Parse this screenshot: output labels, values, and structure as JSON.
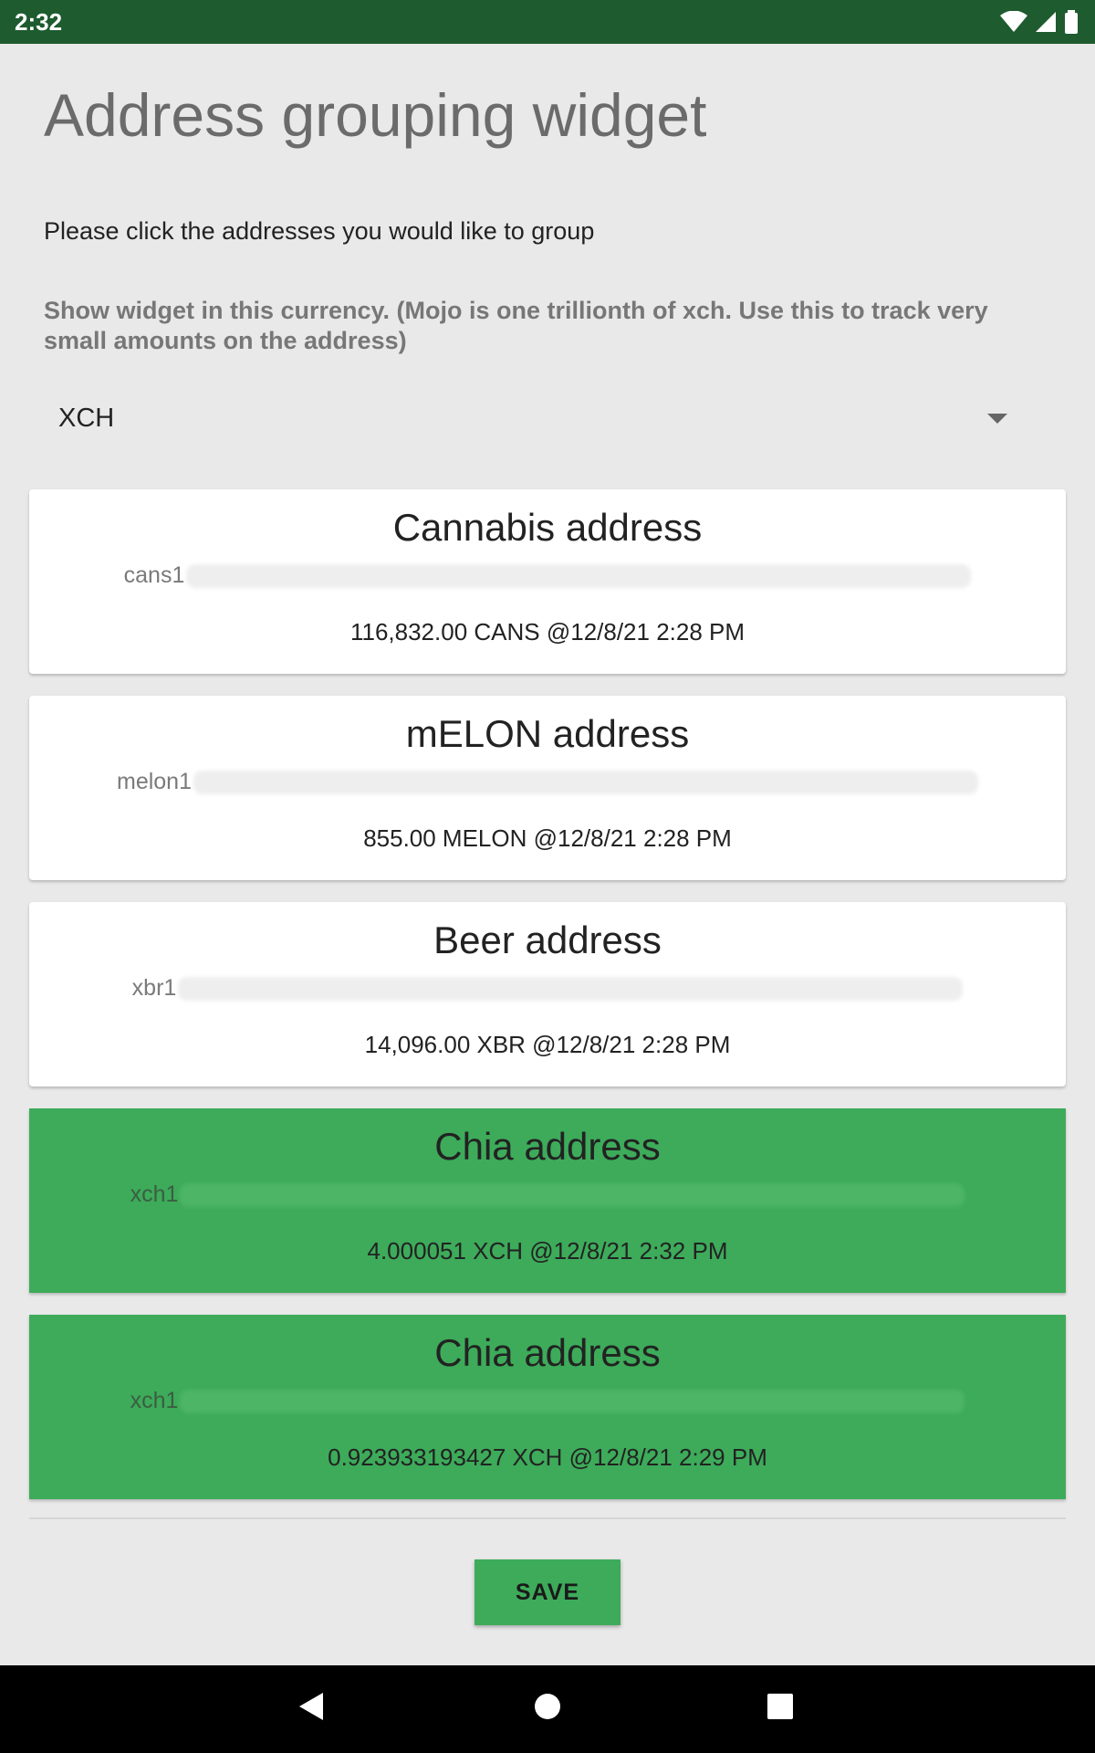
{
  "status_bar": {
    "time": "2:32",
    "icons": [
      "wifi-icon",
      "signal-icon",
      "battery-icon"
    ]
  },
  "page": {
    "title": "Address grouping widget",
    "instruction": "Please click the addresses you would like to group",
    "currency_help": "Show widget in this currency. (Mojo is one trillionth of xch. Use this to track very small amounts on the address)",
    "currency_selected": "XCH"
  },
  "addresses": [
    {
      "name": "Cannabis address",
      "prefix": "cans1",
      "balance": "116,832.00 CANS @12/8/21 2:28 PM",
      "selected": false
    },
    {
      "name": "mELON address",
      "prefix": "melon1",
      "balance": "855.00 MELON @12/8/21 2:28 PM",
      "selected": false
    },
    {
      "name": "Beer address",
      "prefix": "xbr1",
      "balance": "14,096.00 XBR @12/8/21 2:28 PM",
      "selected": false
    },
    {
      "name": "Chia address",
      "prefix": "xch1",
      "balance": "4.000051 XCH @12/8/21 2:32 PM",
      "selected": true
    },
    {
      "name": "Chia address",
      "prefix": "xch1",
      "balance": "0.923933193427 XCH @12/8/21 2:29 PM",
      "selected": true
    }
  ],
  "actions": {
    "save_label": "SAVE"
  },
  "colors": {
    "status_bar": "#1e5b2f",
    "accent_green": "#3dab5a",
    "background": "#e9e9e9"
  }
}
